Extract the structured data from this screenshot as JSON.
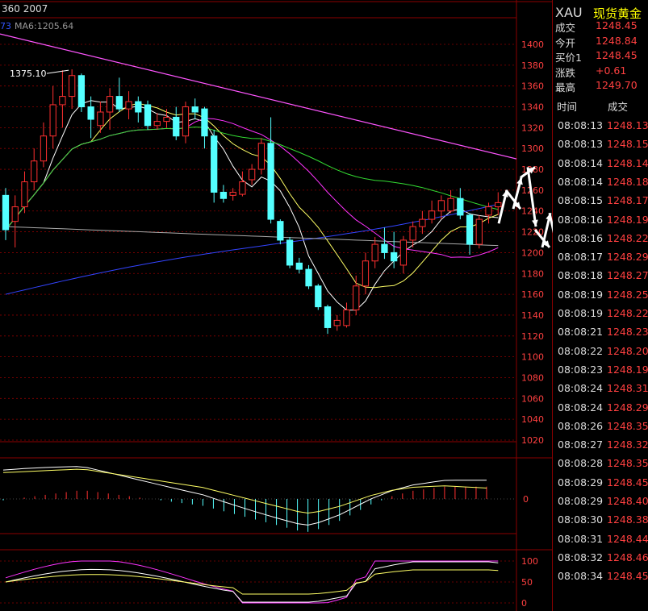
{
  "header": {
    "left_text": "360 2007",
    "ma_prefix": "73",
    "ma6_text": "MA6:1205.64"
  },
  "quote": {
    "symbol": "XAU",
    "name": "现货黄金",
    "rows": [
      {
        "label": "成交",
        "value": "1248.45"
      },
      {
        "label": "今开",
        "value": "1248.84"
      },
      {
        "label": "买价1",
        "value": "1248.45"
      },
      {
        "label": "涨跌",
        "value": "+0.61"
      },
      {
        "label": "最高",
        "value": "1249.70"
      }
    ]
  },
  "ticks": {
    "header_time": "时间",
    "header_price": "成交",
    "rows": [
      {
        "time": "08:08:13",
        "price": "1248.13"
      },
      {
        "time": "08:08:13",
        "price": "1248.15"
      },
      {
        "time": "08:08:14",
        "price": "1248.14"
      },
      {
        "time": "08:08:14",
        "price": "1248.18"
      },
      {
        "time": "08:08:15",
        "price": "1248.17"
      },
      {
        "time": "08:08:16",
        "price": "1248.19"
      },
      {
        "time": "08:08:16",
        "price": "1248.22"
      },
      {
        "time": "08:08:17",
        "price": "1248.29"
      },
      {
        "time": "08:08:18",
        "price": "1248.27"
      },
      {
        "time": "08:08:19",
        "price": "1248.25"
      },
      {
        "time": "08:08:19",
        "price": "1248.22"
      },
      {
        "time": "08:08:21",
        "price": "1248.23"
      },
      {
        "time": "08:08:22",
        "price": "1248.20"
      },
      {
        "time": "08:08:23",
        "price": "1248.19"
      },
      {
        "time": "08:08:24",
        "price": "1248.31"
      },
      {
        "time": "08:08:24",
        "price": "1248.29"
      },
      {
        "time": "08:08:26",
        "price": "1248.35"
      },
      {
        "time": "08:08:27",
        "price": "1248.32"
      },
      {
        "time": "08:08:28",
        "price": "1248.35"
      },
      {
        "time": "08:08:29",
        "price": "1248.45"
      },
      {
        "time": "08:08:29",
        "price": "1248.40"
      },
      {
        "time": "08:08:30",
        "price": "1248.38"
      },
      {
        "time": "08:08:31",
        "price": "1248.44"
      },
      {
        "time": "08:08:32",
        "price": "1248.46"
      },
      {
        "time": "08:08:34",
        "price": "1248.45"
      }
    ]
  },
  "colors": {
    "background": "#000000",
    "grid": "#8b0000",
    "axis_text": "#ff4040",
    "up": "#ff3030",
    "down": "#54ffff",
    "ma_white": "#ffffff",
    "ma_yellow": "#ffff66",
    "ma_magenta": "#ff33ff",
    "ma_green": "#33dd33",
    "ma_blue": "#3344ff",
    "ma_gray": "#aaaaaa",
    "trend": "#ff55ff",
    "arrows": "#ffffff",
    "quote_yellow": "#ffff00"
  },
  "chart_data": [
    {
      "type": "candlestick",
      "title": "",
      "ylim": [
        1020,
        1420
      ],
      "y_ticks": [
        1020,
        1040,
        1060,
        1080,
        1100,
        1120,
        1140,
        1160,
        1180,
        1200,
        1220,
        1240,
        1260,
        1280,
        1300,
        1320,
        1340,
        1360,
        1380,
        1400
      ],
      "high_label": "1375.10",
      "candles": [
        {
          "o": 1255,
          "c": 1222,
          "h": 1262,
          "l": 1212
        },
        {
          "o": 1230,
          "c": 1244,
          "h": 1255,
          "l": 1205
        },
        {
          "o": 1244,
          "c": 1268,
          "h": 1278,
          "l": 1238
        },
        {
          "o": 1268,
          "c": 1288,
          "h": 1300,
          "l": 1260
        },
        {
          "o": 1288,
          "c": 1312,
          "h": 1325,
          "l": 1282
        },
        {
          "o": 1312,
          "c": 1342,
          "h": 1360,
          "l": 1300
        },
        {
          "o": 1342,
          "c": 1350,
          "h": 1375.1,
          "l": 1320
        },
        {
          "o": 1350,
          "c": 1370,
          "h": 1376,
          "l": 1338
        },
        {
          "o": 1370,
          "c": 1340,
          "h": 1372,
          "l": 1335
        },
        {
          "o": 1340,
          "c": 1328,
          "h": 1350,
          "l": 1310
        },
        {
          "o": 1322,
          "c": 1335,
          "h": 1345,
          "l": 1315
        },
        {
          "o": 1335,
          "c": 1350,
          "h": 1358,
          "l": 1318
        },
        {
          "o": 1350,
          "c": 1338,
          "h": 1368,
          "l": 1335
        },
        {
          "o": 1338,
          "c": 1345,
          "h": 1355,
          "l": 1328
        },
        {
          "o": 1345,
          "c": 1335,
          "h": 1350,
          "l": 1325
        },
        {
          "o": 1342,
          "c": 1322,
          "h": 1346,
          "l": 1318
        },
        {
          "o": 1322,
          "c": 1326,
          "h": 1334,
          "l": 1318
        },
        {
          "o": 1326,
          "c": 1330,
          "h": 1338,
          "l": 1320
        },
        {
          "o": 1330,
          "c": 1312,
          "h": 1340,
          "l": 1308
        },
        {
          "o": 1312,
          "c": 1340,
          "h": 1345,
          "l": 1305
        },
        {
          "o": 1340,
          "c": 1335,
          "h": 1348,
          "l": 1328
        },
        {
          "o": 1338,
          "c": 1312,
          "h": 1340,
          "l": 1300
        },
        {
          "o": 1312,
          "c": 1258,
          "h": 1318,
          "l": 1248
        },
        {
          "o": 1258,
          "c": 1252,
          "h": 1265,
          "l": 1248
        },
        {
          "o": 1255,
          "c": 1258,
          "h": 1262,
          "l": 1250
        },
        {
          "o": 1256,
          "c": 1268,
          "h": 1278,
          "l": 1254
        },
        {
          "o": 1270,
          "c": 1280,
          "h": 1285,
          "l": 1265
        },
        {
          "o": 1280,
          "c": 1305,
          "h": 1310,
          "l": 1275
        },
        {
          "o": 1305,
          "c": 1232,
          "h": 1330,
          "l": 1228
        },
        {
          "o": 1230,
          "c": 1212,
          "h": 1232,
          "l": 1208
        },
        {
          "o": 1212,
          "c": 1188,
          "h": 1215,
          "l": 1185
        },
        {
          "o": 1190,
          "c": 1184,
          "h": 1195,
          "l": 1180
        },
        {
          "o": 1184,
          "c": 1168,
          "h": 1188,
          "l": 1165
        },
        {
          "o": 1168,
          "c": 1148,
          "h": 1170,
          "l": 1145
        },
        {
          "o": 1148,
          "c": 1128,
          "h": 1150,
          "l": 1122
        },
        {
          "o": 1130,
          "c": 1135,
          "h": 1140,
          "l": 1125
        },
        {
          "o": 1130,
          "c": 1145,
          "h": 1152,
          "l": 1128
        },
        {
          "o": 1145,
          "c": 1168,
          "h": 1178,
          "l": 1140
        },
        {
          "o": 1168,
          "c": 1192,
          "h": 1200,
          "l": 1160
        },
        {
          "o": 1192,
          "c": 1208,
          "h": 1215,
          "l": 1185
        },
        {
          "o": 1208,
          "c": 1200,
          "h": 1224,
          "l": 1194
        },
        {
          "o": 1200,
          "c": 1192,
          "h": 1220,
          "l": 1185
        },
        {
          "o": 1188,
          "c": 1212,
          "h": 1216,
          "l": 1180
        },
        {
          "o": 1212,
          "c": 1225,
          "h": 1230,
          "l": 1205
        },
        {
          "o": 1225,
          "c": 1232,
          "h": 1240,
          "l": 1218
        },
        {
          "o": 1232,
          "c": 1240,
          "h": 1250,
          "l": 1228
        },
        {
          "o": 1240,
          "c": 1250,
          "h": 1255,
          "l": 1232
        },
        {
          "o": 1240,
          "c": 1252,
          "h": 1260,
          "l": 1238
        },
        {
          "o": 1252,
          "c": 1236,
          "h": 1262,
          "l": 1232
        },
        {
          "o": 1236,
          "c": 1208,
          "h": 1238,
          "l": 1198
        },
        {
          "o": 1208,
          "c": 1232,
          "h": 1236,
          "l": 1204
        },
        {
          "o": 1236,
          "c": 1244,
          "h": 1248,
          "l": 1228
        },
        {
          "o": 1244,
          "c": 1248,
          "h": 1258,
          "l": 1236
        }
      ],
      "trendline": [
        1410,
        1290
      ],
      "projection_arrows": [
        [
          1228,
          1260
        ],
        [
          1260,
          1242
        ],
        [
          1242,
          1272
        ],
        [
          1272,
          1282
        ],
        [
          1282,
          1225
        ],
        [
          1222,
          1205
        ],
        [
          1205,
          1238
        ],
        [
          1238,
          1175
        ]
      ]
    },
    {
      "type": "macd",
      "zero_label": "0",
      "hist": [
        -1,
        0,
        1,
        2,
        3,
        4,
        5,
        6,
        6,
        5,
        4,
        3,
        2,
        1,
        0,
        -1,
        -2,
        -3,
        -4,
        -5,
        -7,
        -9,
        -11,
        -13,
        -15,
        -17,
        -19,
        -21,
        -23,
        -24,
        -22,
        -19,
        -16,
        -12,
        -8,
        -4,
        -1,
        2,
        4,
        6,
        7,
        8,
        9,
        9,
        9,
        9,
        9
      ]
    },
    {
      "type": "kdj",
      "y_ticks": [
        0,
        50,
        100
      ]
    }
  ]
}
